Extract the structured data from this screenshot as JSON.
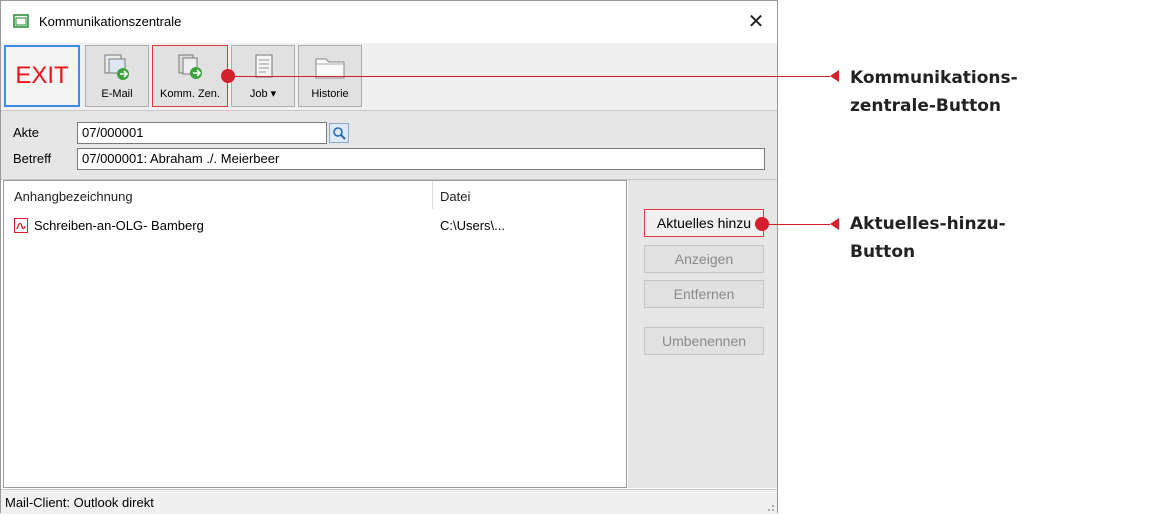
{
  "window": {
    "title": "Kommunikationszentrale",
    "close_glyph": "✕"
  },
  "toolbar": {
    "exit_label": "EXIT",
    "email_label": "E-Mail",
    "komm_label": "Komm. Zen.",
    "job_label": "Job ▾",
    "historie_label": "Historie"
  },
  "fields": {
    "akte_label": "Akte",
    "akte_value": "07/000001",
    "betreff_label": "Betreff",
    "betreff_value": "07/000001: Abraham ./. Meierbeer"
  },
  "list": {
    "col_name": "Anhangbezeichnung",
    "col_file": "Datei",
    "rows": [
      {
        "name": "Schreiben-an-OLG- Bamberg",
        "file": "C:\\Users\\..."
      }
    ]
  },
  "side_buttons": {
    "aktuelles": "Aktuelles hinzu",
    "anzeigen": "Anzeigen",
    "entfernen": "Entfernen",
    "umbenennen": "Umbenennen"
  },
  "status": {
    "text": "Mail-Client: Outlook direkt"
  },
  "callouts": {
    "komm_line1": "Kommunikations-",
    "komm_line2": "zentrale-Button",
    "akt_line1": "Aktuelles-hinzu-",
    "akt_line2": "Button"
  },
  "colors": {
    "accent_red": "#d4202c",
    "exit_red": "#e8141c",
    "focus_blue": "#3a8ee6"
  }
}
